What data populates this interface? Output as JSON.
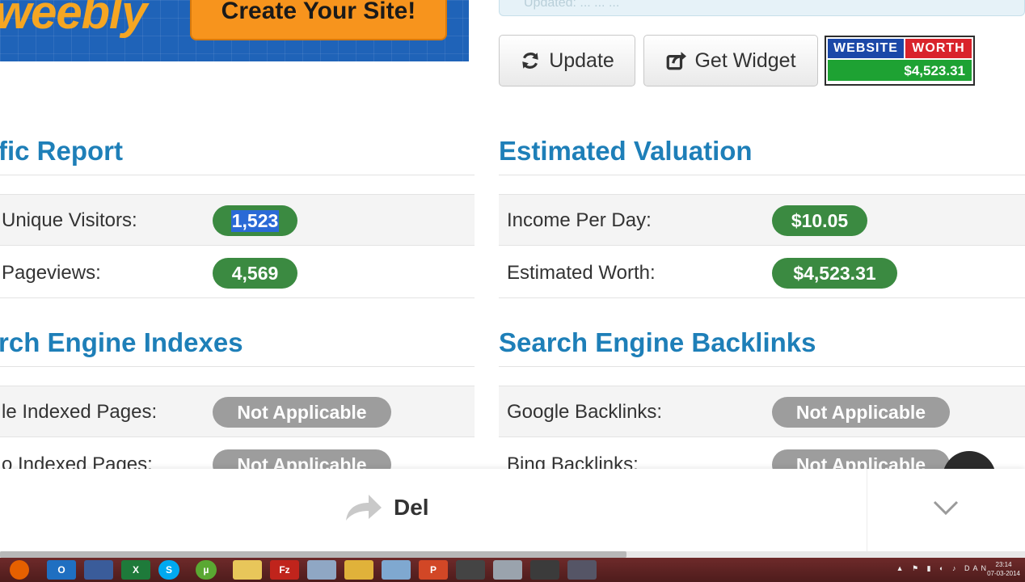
{
  "banner": {
    "logo": "weebly",
    "cta": "Create Your Site!"
  },
  "status_strip": "Updated: ... ... ...",
  "toolbar": {
    "update_label": "Update",
    "widget_label": "Get Widget"
  },
  "worth_widget": {
    "website": "WEBSITE",
    "worth": "WORTH",
    "value": "$4,523.31"
  },
  "traffic": {
    "title": "fic Report",
    "rows": [
      {
        "label": "Unique Visitors:",
        "value_selected": "1,523"
      },
      {
        "label": "Pageviews:",
        "value": "4,569"
      }
    ]
  },
  "valuation": {
    "title": "Estimated Valuation",
    "rows": [
      {
        "label": "Income Per Day:",
        "value": "$10.05"
      },
      {
        "label": "Estimated Worth:",
        "value": "$4,523.31"
      }
    ]
  },
  "indexes": {
    "title": "rch Engine Indexes",
    "rows": [
      {
        "label": "le Indexed Pages:",
        "value": "Not Applicable"
      },
      {
        "label": "o Indexed Pages:",
        "value": "Not Applicable"
      }
    ]
  },
  "backlinks": {
    "title": "Search Engine Backlinks",
    "rows": [
      {
        "label": "Google Backlinks:",
        "value": "Not Applicable"
      },
      {
        "label": "Bing Backlinks:",
        "value": "Not Applicable"
      }
    ]
  },
  "overlay": {
    "action_label": "Del"
  },
  "taskbar": {
    "icons": [
      "firefox-icon",
      "outlook-icon",
      "save-icon",
      "excel-icon",
      "skype-icon",
      "utorrent-icon",
      "folder-icon",
      "filezilla-icon",
      "computer-icon",
      "paint-icon",
      "notepad-icon",
      "powerpoint-icon",
      "media-icon",
      "magnifier-icon",
      "camera-icon",
      "app-icon"
    ],
    "tray_lang": "DAN",
    "time": "23:14",
    "date": "07-03-2014"
  },
  "colors": {
    "accent_blue": "#1e7fb8",
    "pill_green": "#3b8a41",
    "pill_grey": "#9d9d9d"
  }
}
